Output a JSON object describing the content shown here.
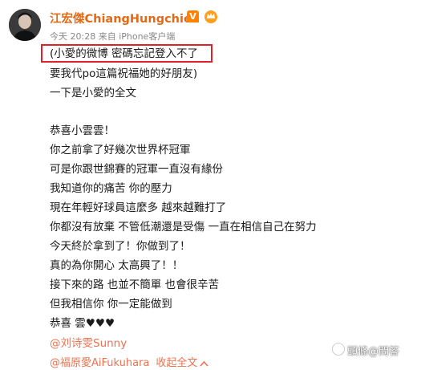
{
  "post": {
    "username": "江宏傑ChiangHungchieh",
    "verified_badge": "V",
    "meta": "今天 20:28 来自 iPhone客户端",
    "lines": [
      "(小愛的微博 密碼忘記登入不了",
      "要我代po這篇祝福她的好朋友)",
      "一下是小愛的全文",
      "恭喜小雲雲！",
      "你之前拿了好幾次世界杯冠軍",
      "可是你跟世錦賽的冠軍一直沒有緣份",
      "我知道你的痛苦 你的壓力",
      "現在年輕好球員這麼多 越來越難打了",
      "你都沒有放棄 不管低潮還是受傷 一直在相信自己在努力",
      "今天終於拿到了！你做到了！",
      "真的為你開心 太高興了！！",
      "接下來的路 也並不簡單 也會很辛苦",
      "但我相信你 你一定能做到",
      "恭喜 雲♥♥♥"
    ],
    "mention_1": "@刘诗雯Sunny",
    "mention_2": "@福原愛AiFukuhara",
    "collapse_label": "收起全文"
  },
  "watermark": {
    "label": "頭條@問答"
  },
  "colors": {
    "username": "#e06a17",
    "mention": "#eb7350",
    "highlight_border": "#e0202a",
    "verified": "#ff8200"
  }
}
